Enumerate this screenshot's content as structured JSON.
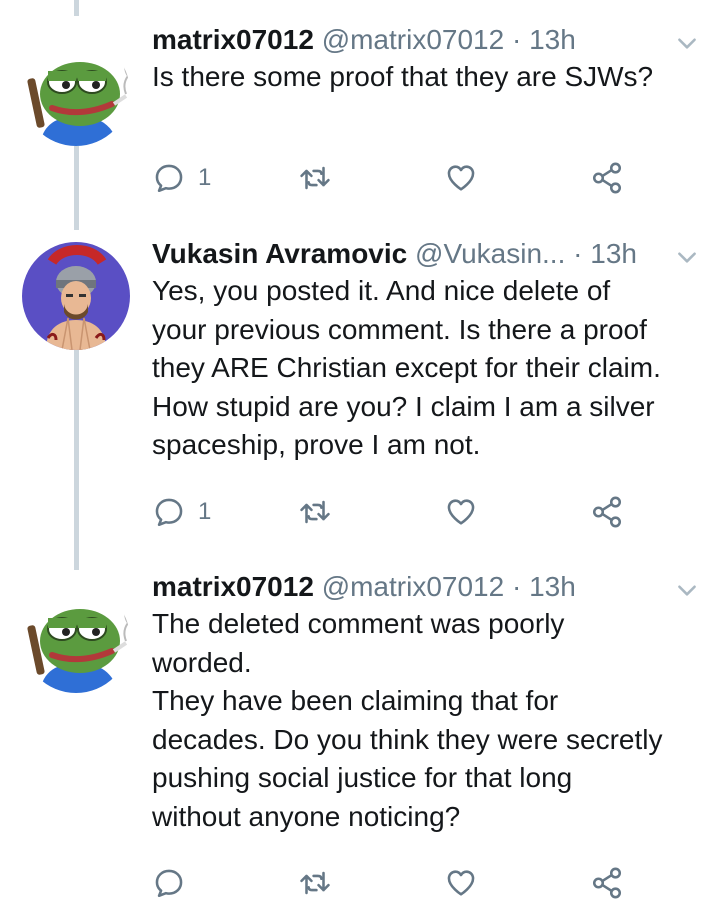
{
  "tweets": [
    {
      "author_name": "matrix07012",
      "handle": "@matrix07012",
      "separator": "·",
      "time": "13h",
      "avatar_icon": "pepe-frog-avatar",
      "lines": [
        "Is there some proof that they are SJWs?"
      ],
      "reply_count": "1"
    },
    {
      "author_name": "Vukasin Avramovic",
      "handle": "@Vukasin...",
      "separator": "·",
      "time": "13h",
      "avatar_icon": "roman-soldier-avatar",
      "lines": [
        "Yes, you posted it. And nice delete of",
        "your previous comment. Is there a proof",
        "they ARE Christian except for their claim.",
        "How stupid are you? I claim I am a silver",
        "spaceship, prove I am not."
      ],
      "reply_count": "1"
    },
    {
      "author_name": "matrix07012",
      "handle": "@matrix07012",
      "separator": "·",
      "time": "13h",
      "avatar_icon": "pepe-frog-avatar",
      "lines": [
        "The deleted comment was poorly",
        "worded.",
        "They have been claiming that for",
        "decades. Do you think they were secretly",
        "pushing social justice for that long",
        "without anyone noticing?"
      ],
      "reply_count": ""
    }
  ],
  "colors": {
    "text": "#14171a",
    "secondary": "#657786",
    "thread_line": "#ccd6dd",
    "frog_green": "#5b9b3f",
    "shirt_blue": "#2f6fd6"
  }
}
